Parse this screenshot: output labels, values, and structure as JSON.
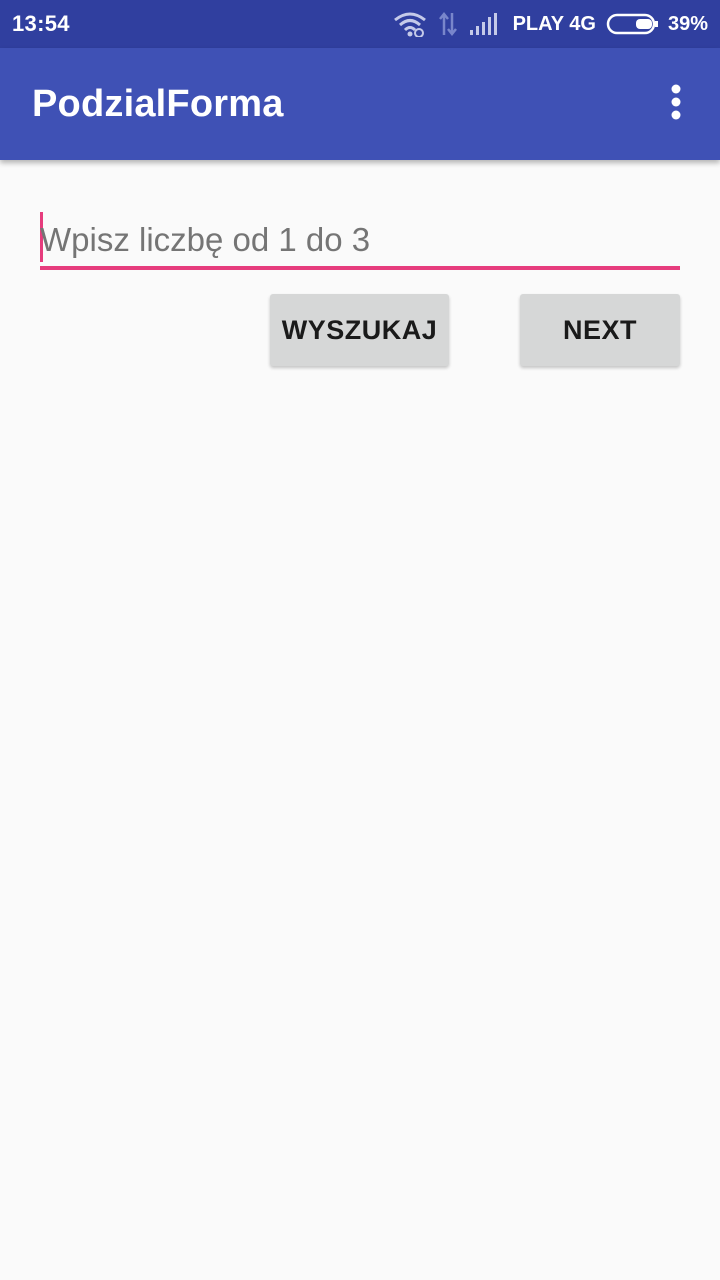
{
  "status_bar": {
    "time": "13:54",
    "carrier": "PLAY 4G",
    "battery_percent": "39%",
    "battery_level": 0.39,
    "icons": [
      "wifi-icon",
      "data-transfer-icon",
      "signal-icon",
      "battery-icon"
    ]
  },
  "app_bar": {
    "title": "PodzialForma",
    "overflow_icon": "more-vert-icon"
  },
  "form": {
    "input_value": "",
    "input_placeholder": "Wpisz liczbę od 1 do 3",
    "search_label": "WYSZUKAJ",
    "next_label": "NEXT"
  },
  "colors": {
    "status_bar": "#303f9f",
    "app_bar": "#3f51b5",
    "accent": "#e63c7d",
    "button": "#d6d7d7",
    "background": "#fafafa"
  }
}
